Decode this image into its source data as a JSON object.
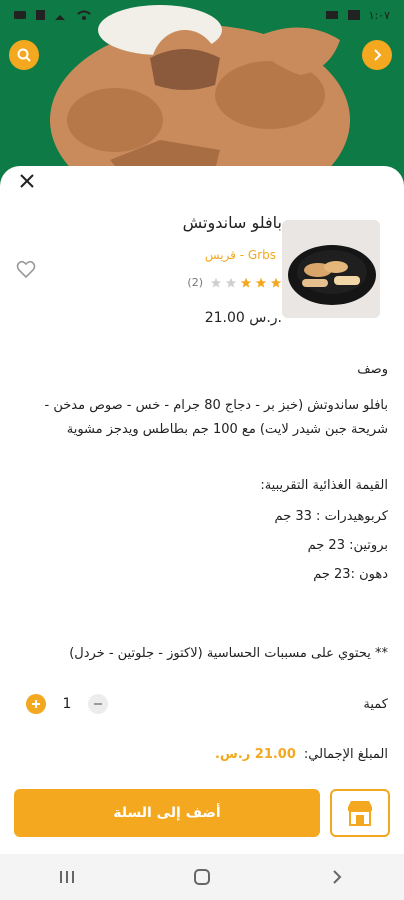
{
  "status_bar": {
    "time": "١:٠٧",
    "icons": [
      "wifi-icon",
      "signal-icon",
      "battery-icon"
    ]
  },
  "top_actions": {
    "search_icon": "search-icon",
    "next_icon": "chevron-right-icon"
  },
  "product": {
    "title": "بافلو ساندوتش",
    "category": "Grbs - قريس",
    "rating_count": "(2)",
    "stars_filled": 3,
    "stars_total": 5,
    "price": "21.00 ر.س."
  },
  "sections": {
    "description_title": "وصف",
    "description": "بافلو ساندوتش (خبز بر - دجاج 80 جرام - خس - صوص مدخن - شريحة جبن شيدر لايت) مع 100 جم بطاطس ويدجز مشوية",
    "nutrition_title": "القيمة الغذائية التقريبية:",
    "nutrition": [
      "كربوهيدرات : 33 جم",
      "بروتين: 23 جم",
      "دهون :23 جم"
    ],
    "allergen": "** يحتوي على مسببات الحساسية (لاكتوز - جلوتين - خردل)"
  },
  "quantity": {
    "label": "كمية",
    "value": "1"
  },
  "total": {
    "label": "المبلغ الإجمالي:",
    "amount": "21.00 ر.س."
  },
  "actions": {
    "add_to_cart": "أضف إلى السلة"
  },
  "colors": {
    "accent": "#f3a81f",
    "header_green": "#0e7a45"
  }
}
